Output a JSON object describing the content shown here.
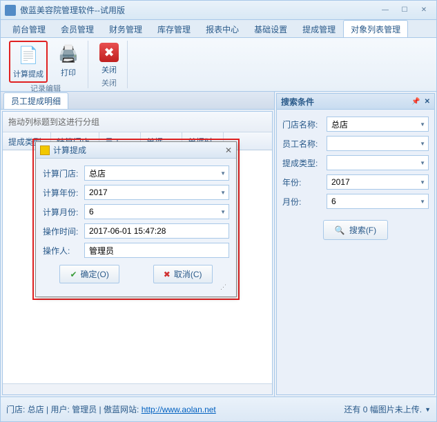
{
  "window": {
    "title": "傲蓝美容院管理软件--试用版"
  },
  "tabs": [
    "前台管理",
    "会员管理",
    "财务管理",
    "库存管理",
    "报表中心",
    "基础设置",
    "提成管理",
    "对象列表管理"
  ],
  "active_tab_index": 7,
  "ribbon": {
    "groups": [
      {
        "label": "记录编辑",
        "items": [
          {
            "label": "计算提成",
            "icon": "📄",
            "highlight": true
          },
          {
            "label": "打印",
            "icon": "🖨️"
          }
        ]
      },
      {
        "label": "关闭",
        "items": [
          {
            "label": "关闭",
            "icon": "✖"
          }
        ]
      }
    ]
  },
  "sub_tab": "员工提成明细",
  "grid": {
    "group_hint": "拖动列标题到这进行分组",
    "columns": [
      "提成类型",
      "结算门店",
      "员工",
      "单据",
      "单据时"
    ]
  },
  "dialog": {
    "title": "计算提成",
    "rows": [
      {
        "label": "计算门店:",
        "value": "总店",
        "type": "dropdown"
      },
      {
        "label": "计算年份:",
        "value": "2017",
        "type": "dropdown"
      },
      {
        "label": "计算月份:",
        "value": "6",
        "type": "dropdown"
      },
      {
        "label": "操作时间:",
        "value": "2017-06-01 15:47:28",
        "type": "text"
      },
      {
        "label": "操作人:",
        "value": "管理员",
        "type": "text"
      }
    ],
    "ok": "确定(O)",
    "cancel": "取消(C)"
  },
  "search_panel": {
    "title": "搜索条件",
    "rows": [
      {
        "label": "门店名称:",
        "value": "总店",
        "type": "dropdown"
      },
      {
        "label": "员工名称:",
        "value": "",
        "type": "dropdown"
      },
      {
        "label": "提成类型:",
        "value": "",
        "type": "dropdown"
      },
      {
        "label": "年份:",
        "value": "2017",
        "type": "dropdown"
      },
      {
        "label": "月份:",
        "value": "6",
        "type": "dropdown"
      }
    ],
    "button": "搜索(F)"
  },
  "status": {
    "store_label": "门店:",
    "store": "总店",
    "user_label": "用户:",
    "user": "管理员",
    "site_label": "傲蓝网站:",
    "site": "http://www.aolan.net",
    "upload": "还有 0 幅图片未上传."
  }
}
